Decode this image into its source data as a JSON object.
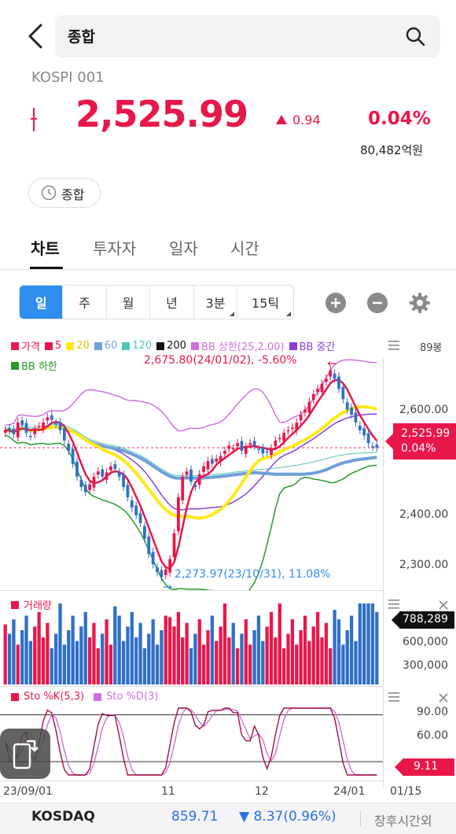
{
  "header": {
    "search_text": "종합"
  },
  "index": {
    "code": "KOSPI 001",
    "price": "2,525.99",
    "change": "0.94",
    "change_pct": "0.04%",
    "trade_amount": "80,482억원",
    "session": "종합",
    "up_color": "#e8174a"
  },
  "tabs": [
    {
      "label": "차트",
      "active": true
    },
    {
      "label": "투자자",
      "active": false
    },
    {
      "label": "일자",
      "active": false
    },
    {
      "label": "시간",
      "active": false
    }
  ],
  "periods": [
    {
      "label": "일",
      "active": true
    },
    {
      "label": "주"
    },
    {
      "label": "월"
    },
    {
      "label": "년"
    },
    {
      "label": "3분",
      "more": true
    },
    {
      "label": "15틱",
      "more": true
    }
  ],
  "legend": [
    {
      "label": "가격",
      "color": "#e8174a"
    },
    {
      "label": "5",
      "color": "#e8174a"
    },
    {
      "label": "20",
      "color": "#ffe81a"
    },
    {
      "label": "60",
      "color": "#6fa0d8"
    },
    {
      "label": "120",
      "color": "#4fc7b8"
    },
    {
      "label": "200",
      "color": "#111111"
    },
    {
      "label": "BB 상한(25,2.00)",
      "color": "#d070e0"
    },
    {
      "label": "BB 중간",
      "color": "#8a3fd8"
    },
    {
      "label": "BB 하한",
      "color": "#2a9a2a"
    }
  ],
  "candles_count": "89봉",
  "annotations": {
    "high": "2,675.80(24/01/02), -5.60%",
    "low": "2,273.97(23/10/31), 11.08%"
  },
  "price_axis": [
    "2,600.00",
    "2,400.00",
    "2,300.00"
  ],
  "price_flag": {
    "price": "2,525.99",
    "pct": "0.04%"
  },
  "volume_panel": {
    "label": "거래량",
    "axis": [
      "600,000",
      "300,000"
    ],
    "flag": "788,289"
  },
  "sto_panel": {
    "label_k": "Sto %K(5,3)",
    "label_d": "Sto %D(3)",
    "axis": [
      "90.00",
      "60.00"
    ],
    "flag": "9.11"
  },
  "x_axis": [
    "23/09/01",
    "11",
    "12",
    "24/01",
    "01/15"
  ],
  "ticker": {
    "name": "KOSDAQ",
    "price": "859.71",
    "change": "8.37",
    "change_pct": "(0.96%)",
    "status": "장후시간외",
    "down_color": "#2970e8"
  },
  "chart_data": {
    "type": "line",
    "candles": 89,
    "close": [
      2560,
      2558,
      2552,
      2575,
      2570,
      2555,
      2548,
      2562,
      2568,
      2575,
      2585,
      2580,
      2572,
      2560,
      2540,
      2520,
      2495,
      2470,
      2450,
      2440,
      2455,
      2470,
      2480,
      2470,
      2478,
      2490,
      2485,
      2470,
      2450,
      2430,
      2410,
      2395,
      2380,
      2350,
      2320,
      2300,
      2285,
      2275,
      2290,
      2310,
      2360,
      2430,
      2470,
      2480,
      2460,
      2450,
      2475,
      2490,
      2500,
      2495,
      2505,
      2510,
      2520,
      2530,
      2525,
      2535,
      2520,
      2528,
      2535,
      2530,
      2522,
      2515,
      2518,
      2525,
      2540,
      2545,
      2555,
      2560,
      2565,
      2575,
      2590,
      2600,
      2615,
      2630,
      2640,
      2650,
      2660,
      2676,
      2660,
      2640,
      2620,
      2600,
      2590,
      2575,
      2560,
      2550,
      2535,
      2528,
      2526
    ],
    "ylim": [
      2250,
      2700
    ],
    "volume_ylim": [
      0,
      850000
    ],
    "sto_ylim": [
      0,
      100
    ]
  }
}
